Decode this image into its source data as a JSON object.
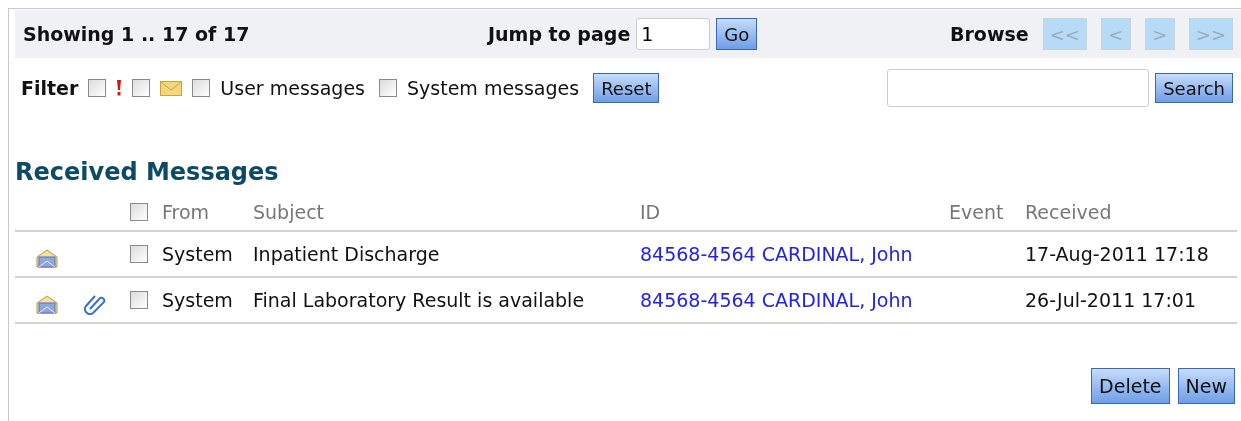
{
  "pager": {
    "showing": "Showing 1 .. 17 of 17",
    "jump_label": "Jump to page",
    "jump_value": "1",
    "go_button": "Go",
    "browse_label": "Browse",
    "nav_buttons": [
      {
        "label": "<<",
        "disabled": true
      },
      {
        "label": "<",
        "disabled": true
      },
      {
        "label": ">",
        "disabled": true
      },
      {
        "label": ">>",
        "disabled": true
      }
    ]
  },
  "filter": {
    "label": "Filter",
    "options": [
      {
        "kind": "urgent",
        "checked": false
      },
      {
        "kind": "mail",
        "checked": false
      },
      {
        "kind": "text",
        "label": "User messages",
        "checked": false
      },
      {
        "kind": "text",
        "label": "System messages",
        "checked": false
      }
    ],
    "reset_button": "Reset"
  },
  "search": {
    "button": "Search"
  },
  "heading": "Received Messages",
  "table": {
    "select_all": {
      "checked": false
    },
    "columns": [
      "From",
      "Subject",
      "ID",
      "Event",
      "Received"
    ],
    "rows": [
      {
        "attachment": false,
        "checked": false,
        "from": "System",
        "subject": "Inpatient Discharge",
        "id": "84568-4564 CARDINAL, John",
        "received": "17-Aug-2011 17:18"
      },
      {
        "attachment": true,
        "checked": false,
        "from": "System",
        "subject": "Final Laboratory Result is available",
        "id": "84568-4564 CARDINAL, John",
        "received": "26-Jul-2011 17:01"
      }
    ]
  },
  "buttons": [
    "Delete",
    "New"
  ]
}
